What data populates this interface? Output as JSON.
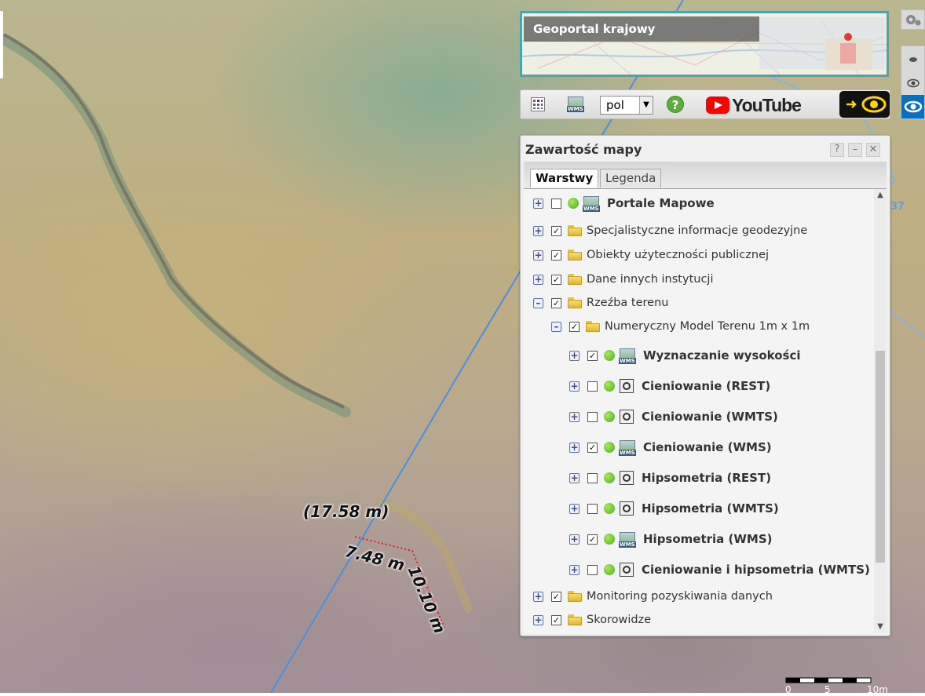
{
  "measurements": {
    "area_label": "(17.58 m)",
    "side_a": "7.48 m",
    "side_b": "10.10 m"
  },
  "overview": {
    "title": "Geoportal krajowy"
  },
  "toolbar": {
    "language": "pol",
    "help_symbol": "?",
    "youtube_label": "YouTube",
    "icons": [
      "layers-grid-icon",
      "wms-add-icon",
      "help-icon",
      "youtube-icon",
      "eye-toggle-icon"
    ]
  },
  "right_controls": {
    "icons": [
      "settings-gear-icon",
      "eye-small-icon",
      "eye-medium-icon",
      "eye-large-icon"
    ]
  },
  "map_edge_text": "37",
  "panel": {
    "title": "Zawartość mapy",
    "buttons": [
      "?",
      "–",
      "✕"
    ],
    "tabs": {
      "active": "Warstwy",
      "inactive": "Legenda"
    },
    "rows": [
      {
        "label": "Portale Mapowe",
        "level": 0,
        "expander": "+",
        "checked": false,
        "dot": true,
        "icon": "wms",
        "bold": true
      },
      {
        "label": "Specjalistyczne informacje geodezyjne",
        "level": 0,
        "expander": "+",
        "checked": true,
        "icon": "folder"
      },
      {
        "label": "Obiekty użyteczności publicznej",
        "level": 0,
        "expander": "+",
        "checked": true,
        "icon": "folder"
      },
      {
        "label": "Dane innych instytucji",
        "level": 0,
        "expander": "+",
        "checked": true,
        "icon": "folder"
      },
      {
        "label": "Rzeźba terenu",
        "level": 0,
        "expander": "–",
        "checked": true,
        "icon": "folder"
      },
      {
        "label": "Numeryczny Model Terenu 1m x 1m",
        "level": 1,
        "expander": "–",
        "checked": true,
        "icon": "folder"
      },
      {
        "label": "Wyznaczanie wysokości",
        "level": 2,
        "expander": "+",
        "checked": true,
        "dot": true,
        "icon": "wms",
        "bold": true
      },
      {
        "label": "Cieniowanie (REST)",
        "level": 2,
        "expander": "+",
        "checked": false,
        "dot": true,
        "icon": "tile",
        "bold": true
      },
      {
        "label": "Cieniowanie (WMTS)",
        "level": 2,
        "expander": "+",
        "checked": false,
        "dot": true,
        "icon": "tile",
        "bold": true
      },
      {
        "label": "Cieniowanie (WMS)",
        "level": 2,
        "expander": "+",
        "checked": true,
        "dot": true,
        "icon": "wms",
        "bold": true
      },
      {
        "label": "Hipsometria (REST)",
        "level": 2,
        "expander": "+",
        "checked": false,
        "dot": true,
        "icon": "tile",
        "bold": true
      },
      {
        "label": "Hipsometria (WMTS)",
        "level": 2,
        "expander": "+",
        "checked": false,
        "dot": true,
        "icon": "tile",
        "bold": true
      },
      {
        "label": "Hipsometria (WMS)",
        "level": 2,
        "expander": "+",
        "checked": true,
        "dot": true,
        "icon": "wms",
        "bold": true
      },
      {
        "label": "Cieniowanie i hipsometria (WMTS)",
        "level": 2,
        "expander": "+",
        "checked": false,
        "dot": true,
        "icon": "tile",
        "bold": true
      },
      {
        "label": "Monitoring pozyskiwania danych",
        "level": 0,
        "expander": "+",
        "checked": true,
        "icon": "folder"
      },
      {
        "label": "Skorowidze",
        "level": 0,
        "expander": "+",
        "checked": true,
        "icon": "folder"
      }
    ]
  },
  "scalebar": {
    "labels": [
      "0",
      "5",
      "10m"
    ]
  }
}
